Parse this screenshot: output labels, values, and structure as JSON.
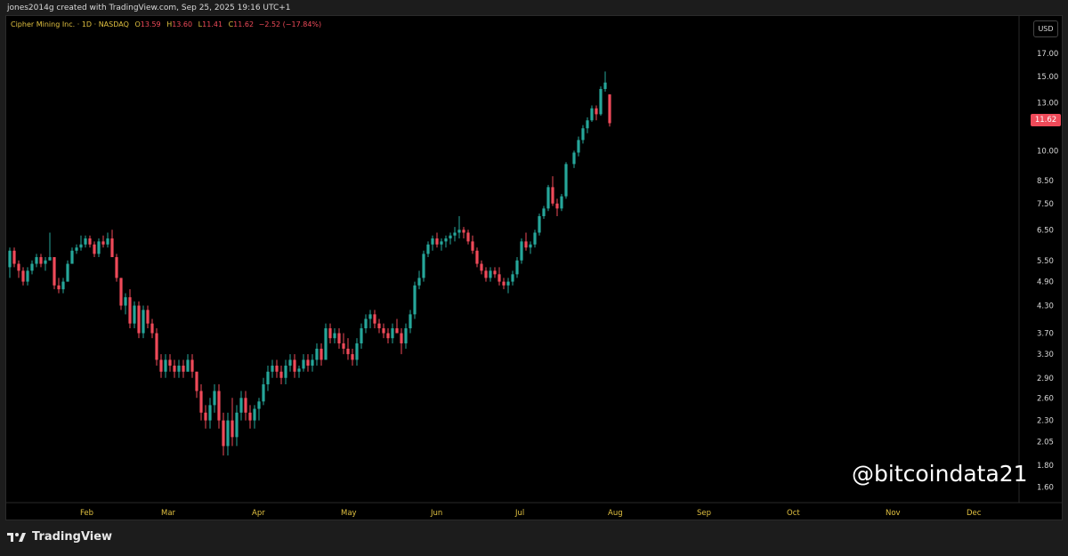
{
  "header": {
    "credit": "jones2014g created with TradingView.com, Sep 25, 2025 19:16 UTC+1"
  },
  "legend": {
    "symbol": "Cipher Mining Inc. · 1D · NASDAQ",
    "o_label": "O",
    "o_value": "13.59",
    "h_label": "H",
    "h_value": "13.60",
    "l_label": "L",
    "l_value": "11.41",
    "c_label": "C",
    "c_value": "11.62",
    "change": "−2.52 (−17.84%)"
  },
  "price_scale": {
    "currency": "USD",
    "last_price": "11.62"
  },
  "watermark": "@bitcoindata21",
  "brand": "TradingView",
  "colors": {
    "up": "#26a69a",
    "down": "#ef4a59",
    "background": "#000000",
    "axis_text": "#d8d8d8",
    "month_labels": "#e0c040"
  },
  "chart_data": {
    "type": "candlestick",
    "y_scale": "log",
    "ylim": [
      1.55,
      17.5
    ],
    "y_ticks": [
      "17.00",
      "15.00",
      "13.00",
      "11.62",
      "10.00",
      "8.50",
      "7.50",
      "6.50",
      "5.50",
      "4.90",
      "4.30",
      "3.70",
      "3.30",
      "2.90",
      "2.60",
      "2.30",
      "2.05",
      "1.80",
      "1.60"
    ],
    "x_ticks": [
      "Feb",
      "Mar",
      "Apr",
      "May",
      "Jun",
      "Jul",
      "Aug",
      "Sep",
      "Oct",
      "Nov",
      "Dec"
    ],
    "candles": [
      [
        5.3,
        5.9,
        5.0,
        5.8
      ],
      [
        5.8,
        5.9,
        5.3,
        5.4
      ],
      [
        5.4,
        5.5,
        5.0,
        5.2
      ],
      [
        5.2,
        5.3,
        4.8,
        4.9
      ],
      [
        4.9,
        5.3,
        4.8,
        5.2
      ],
      [
        5.2,
        5.5,
        5.1,
        5.4
      ],
      [
        5.4,
        5.7,
        5.3,
        5.6
      ],
      [
        5.6,
        5.7,
        5.3,
        5.4
      ],
      [
        5.4,
        5.6,
        5.2,
        5.5
      ],
      [
        5.5,
        6.4,
        5.5,
        5.6
      ],
      [
        5.6,
        5.6,
        4.7,
        4.8
      ],
      [
        4.8,
        5.0,
        4.6,
        4.7
      ],
      [
        4.7,
        5.0,
        4.6,
        4.9
      ],
      [
        4.9,
        5.5,
        4.9,
        5.4
      ],
      [
        5.4,
        5.9,
        5.4,
        5.8
      ],
      [
        5.8,
        6.0,
        5.7,
        5.9
      ],
      [
        5.9,
        6.3,
        5.8,
        6.0
      ],
      [
        6.0,
        6.3,
        5.9,
        6.2
      ],
      [
        6.2,
        6.3,
        5.9,
        6.0
      ],
      [
        6.0,
        6.1,
        5.6,
        5.7
      ],
      [
        5.7,
        6.2,
        5.6,
        6.1
      ],
      [
        6.1,
        6.3,
        5.9,
        6.0
      ],
      [
        6.0,
        6.4,
        5.9,
        6.2
      ],
      [
        6.2,
        6.5,
        6.0,
        5.6
      ],
      [
        5.6,
        5.7,
        4.9,
        5.0
      ],
      [
        5.0,
        5.0,
        4.2,
        4.3
      ],
      [
        4.3,
        4.6,
        4.1,
        4.5
      ],
      [
        4.5,
        4.7,
        3.8,
        3.9
      ],
      [
        3.9,
        4.4,
        3.8,
        4.3
      ],
      [
        4.3,
        4.4,
        3.6,
        3.7
      ],
      [
        3.7,
        4.3,
        3.6,
        4.2
      ],
      [
        4.2,
        4.3,
        3.8,
        3.9
      ],
      [
        3.9,
        4.0,
        3.6,
        3.7
      ],
      [
        3.7,
        3.8,
        3.1,
        3.2
      ],
      [
        3.2,
        3.3,
        2.9,
        3.0
      ],
      [
        3.0,
        3.3,
        2.9,
        3.2
      ],
      [
        3.2,
        3.3,
        3.0,
        3.1
      ],
      [
        3.1,
        3.2,
        2.9,
        3.0
      ],
      [
        3.0,
        3.2,
        2.9,
        3.1
      ],
      [
        3.1,
        3.2,
        2.9,
        3.0
      ],
      [
        3.0,
        3.3,
        3.0,
        3.2
      ],
      [
        3.2,
        3.3,
        2.9,
        3.0
      ],
      [
        3.0,
        3.0,
        2.6,
        2.7
      ],
      [
        2.7,
        2.8,
        2.3,
        2.4
      ],
      [
        2.4,
        2.5,
        2.2,
        2.3
      ],
      [
        2.3,
        2.6,
        2.2,
        2.5
      ],
      [
        2.5,
        2.8,
        2.4,
        2.7
      ],
      [
        2.7,
        2.8,
        2.2,
        2.3
      ],
      [
        2.3,
        2.4,
        1.9,
        2.0
      ],
      [
        2.0,
        2.4,
        1.9,
        2.3
      ],
      [
        2.3,
        2.6,
        2.0,
        2.1
      ],
      [
        2.1,
        2.5,
        2.0,
        2.4
      ],
      [
        2.4,
        2.7,
        2.3,
        2.6
      ],
      [
        2.6,
        2.7,
        2.3,
        2.4
      ],
      [
        2.4,
        2.5,
        2.2,
        2.3
      ],
      [
        2.3,
        2.5,
        2.2,
        2.45
      ],
      [
        2.45,
        2.6,
        2.3,
        2.55
      ],
      [
        2.55,
        2.9,
        2.5,
        2.8
      ],
      [
        2.8,
        3.1,
        2.7,
        3.0
      ],
      [
        3.0,
        3.2,
        2.9,
        3.1
      ],
      [
        3.1,
        3.2,
        2.9,
        3.0
      ],
      [
        3.0,
        3.1,
        2.8,
        2.9
      ],
      [
        2.9,
        3.2,
        2.8,
        3.1
      ],
      [
        3.1,
        3.3,
        3.0,
        3.2
      ],
      [
        3.2,
        3.3,
        2.9,
        3.0
      ],
      [
        3.0,
        3.1,
        2.9,
        3.05
      ],
      [
        3.05,
        3.3,
        3.0,
        3.2
      ],
      [
        3.2,
        3.3,
        3.0,
        3.1
      ],
      [
        3.1,
        3.3,
        3.0,
        3.2
      ],
      [
        3.2,
        3.5,
        3.1,
        3.4
      ],
      [
        3.4,
        3.5,
        3.1,
        3.2
      ],
      [
        3.2,
        3.9,
        3.2,
        3.8
      ],
      [
        3.8,
        3.9,
        3.5,
        3.6
      ],
      [
        3.6,
        3.8,
        3.5,
        3.7
      ],
      [
        3.7,
        3.8,
        3.4,
        3.5
      ],
      [
        3.5,
        3.7,
        3.3,
        3.4
      ],
      [
        3.4,
        3.6,
        3.2,
        3.3
      ],
      [
        3.3,
        3.4,
        3.1,
        3.2
      ],
      [
        3.2,
        3.6,
        3.1,
        3.5
      ],
      [
        3.5,
        3.9,
        3.4,
        3.8
      ],
      [
        3.8,
        4.1,
        3.7,
        4.0
      ],
      [
        4.0,
        4.2,
        3.8,
        4.1
      ],
      [
        4.1,
        4.2,
        3.8,
        3.9
      ],
      [
        3.9,
        4.0,
        3.7,
        3.8
      ],
      [
        3.8,
        3.9,
        3.6,
        3.7
      ],
      [
        3.7,
        3.8,
        3.5,
        3.6
      ],
      [
        3.6,
        3.9,
        3.5,
        3.8
      ],
      [
        3.8,
        4.0,
        3.7,
        3.7
      ],
      [
        3.7,
        3.8,
        3.3,
        3.5
      ],
      [
        3.5,
        3.9,
        3.4,
        3.8
      ],
      [
        3.8,
        4.2,
        3.7,
        4.1
      ],
      [
        4.1,
        4.9,
        4.0,
        4.8
      ],
      [
        4.8,
        5.2,
        4.7,
        5.0
      ],
      [
        5.0,
        5.8,
        4.9,
        5.7
      ],
      [
        5.7,
        6.1,
        5.6,
        6.0
      ],
      [
        6.0,
        6.3,
        5.8,
        6.2
      ],
      [
        6.2,
        6.4,
        5.9,
        6.0
      ],
      [
        6.0,
        6.2,
        5.8,
        6.1
      ],
      [
        6.1,
        6.3,
        5.9,
        6.2
      ],
      [
        6.2,
        6.4,
        6.0,
        6.3
      ],
      [
        6.3,
        6.6,
        6.1,
        6.4
      ],
      [
        6.4,
        7.0,
        6.2,
        6.5
      ],
      [
        6.5,
        6.6,
        6.2,
        6.4
      ],
      [
        6.4,
        6.5,
        6.0,
        6.1
      ],
      [
        6.1,
        6.3,
        5.7,
        5.8
      ],
      [
        5.8,
        5.9,
        5.3,
        5.4
      ],
      [
        5.4,
        5.5,
        5.1,
        5.2
      ],
      [
        5.2,
        5.3,
        4.9,
        5.0
      ],
      [
        5.0,
        5.3,
        4.9,
        5.2
      ],
      [
        5.2,
        5.3,
        5.0,
        5.1
      ],
      [
        5.1,
        5.3,
        4.8,
        4.9
      ],
      [
        4.9,
        5.0,
        4.7,
        4.8
      ],
      [
        4.8,
        5.0,
        4.6,
        4.9
      ],
      [
        4.9,
        5.2,
        4.8,
        5.1
      ],
      [
        5.1,
        5.6,
        5.0,
        5.5
      ],
      [
        5.5,
        6.2,
        5.4,
        6.1
      ],
      [
        6.1,
        6.4,
        5.8,
        5.9
      ],
      [
        5.9,
        6.1,
        5.7,
        6.0
      ],
      [
        6.0,
        6.5,
        5.9,
        6.4
      ],
      [
        6.4,
        7.1,
        6.3,
        7.0
      ],
      [
        7.0,
        7.4,
        6.9,
        7.3
      ],
      [
        7.3,
        8.3,
        7.2,
        8.2
      ],
      [
        8.2,
        8.7,
        7.4,
        7.5
      ],
      [
        7.5,
        7.7,
        7.0,
        7.3
      ],
      [
        7.3,
        7.9,
        7.2,
        7.8
      ],
      [
        7.8,
        9.4,
        7.7,
        9.3
      ],
      [
        9.3,
        10.0,
        9.1,
        9.9
      ],
      [
        9.9,
        10.8,
        9.7,
        10.6
      ],
      [
        10.6,
        11.5,
        10.4,
        11.3
      ],
      [
        11.3,
        12.0,
        11.0,
        11.8
      ],
      [
        11.8,
        12.8,
        11.7,
        12.6
      ],
      [
        12.6,
        12.8,
        11.8,
        12.2
      ],
      [
        12.2,
        14.2,
        12.1,
        14.0
      ],
      [
        14.0,
        15.4,
        13.8,
        14.5
      ],
      [
        13.59,
        13.6,
        11.41,
        11.62
      ]
    ]
  }
}
